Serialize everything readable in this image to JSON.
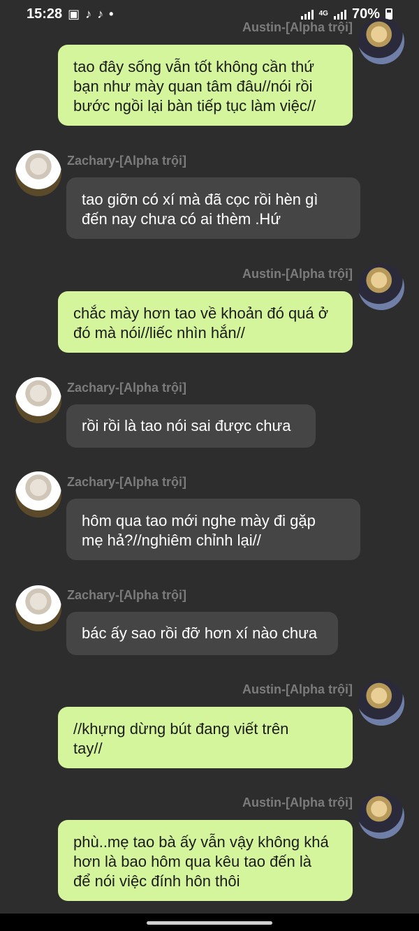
{
  "status": {
    "time": "15:28",
    "network": "4G",
    "battery": "70%"
  },
  "messages": [
    {
      "side": "right",
      "name": "Austin-[Alpha trội]",
      "text": "tao đây sống vẫn tốt không cần thứ\nbạn như mày quan tâm đâu//nói rồi\nbước ngồi lại bàn tiếp tục làm việc//"
    },
    {
      "side": "left",
      "name": "Zachary-[Alpha trội]",
      "text": "tao giỡn có xí mà đã cọc rồi hèn gì\nđến nay chưa có ai thèm .Hứ"
    },
    {
      "side": "right",
      "name": "Austin-[Alpha trội]",
      "text": "chắc mày hơn tao về khoản đó quá ở\nđó mà nói//liếc nhìn hắn//"
    },
    {
      "side": "left",
      "name": "Zachary-[Alpha trội]",
      "text": "rồi rồi là tao nói sai được chưa"
    },
    {
      "side": "left",
      "name": "Zachary-[Alpha trội]",
      "text": "hôm qua tao mới nghe mày đi gặp\nmẹ hả?//nghiêm chỉnh lại//"
    },
    {
      "side": "left",
      "name": "Zachary-[Alpha trội]",
      "text": "bác ấy sao rồi đỡ hơn xí nào chưa"
    },
    {
      "side": "right",
      "name": "Austin-[Alpha trội]",
      "text": "//khựng dừng bút đang viết trên\ntay//"
    },
    {
      "side": "right",
      "name": "Austin-[Alpha trội]",
      "text": "phù..mẹ tao bà ấy vẫn vậy không khá\nhơn là bao hôm qua kêu tao đến là\nđể nói việc đính hôn thôi"
    }
  ]
}
